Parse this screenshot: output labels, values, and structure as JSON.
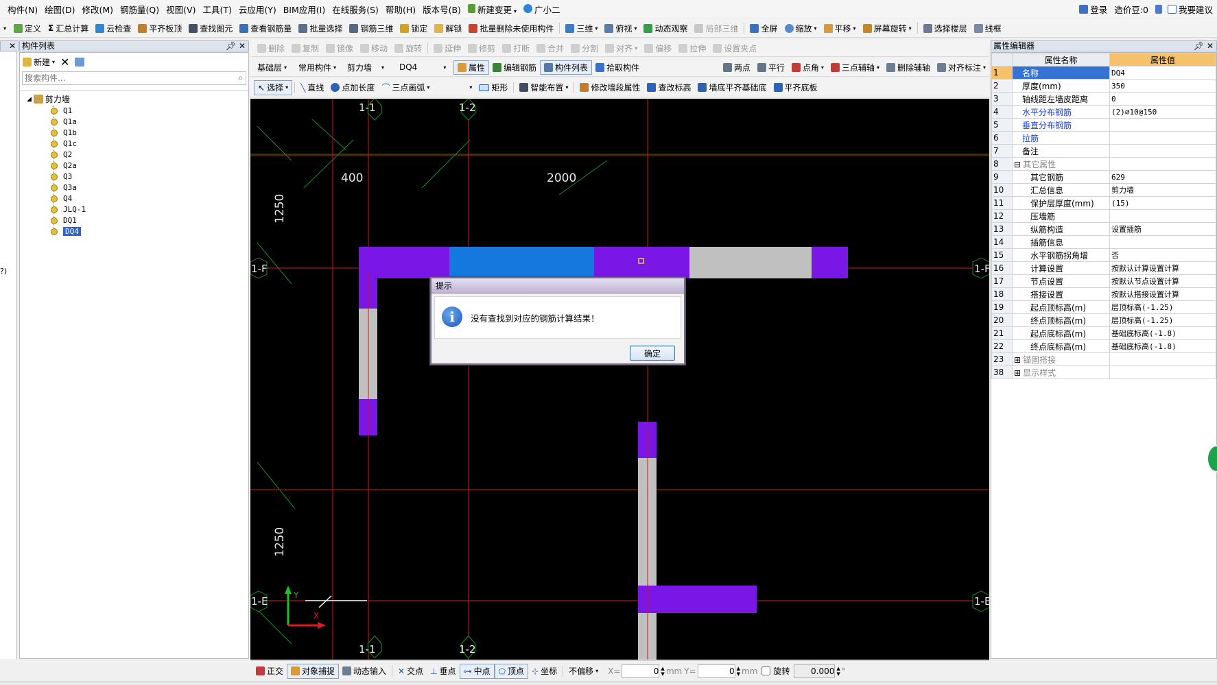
{
  "menubar": [
    "构件(N)",
    "绘图(D)",
    "修改(M)",
    "钢筋量(Q)",
    "视图(V)",
    "工具(T)",
    "云应用(Y)",
    "BIM应用(I)",
    "在线服务(S)",
    "帮助(H)",
    "版本号(B)",
    "新建变更",
    "广小二"
  ],
  "menubar_right": {
    "login": "登录",
    "coins": "造价豆:0",
    "suggest": "我要建议"
  },
  "toolbar1": [
    "定义",
    "汇总计算",
    "云检查",
    "平齐板顶",
    "查找图元",
    "查看钢筋量",
    "批量选择",
    "钢筋三维",
    "锁定",
    "解锁",
    "批量删除未使用构件",
    "三维",
    "俯视",
    "动态观察",
    "局部三维",
    "全屏",
    "缩放",
    "平移",
    "屏幕旋转",
    "选择楼层",
    "线框"
  ],
  "toolbar2": [
    "删除",
    "复制",
    "镜像",
    "移动",
    "旋转",
    "延伸",
    "修剪",
    "打断",
    "合并",
    "分割",
    "对齐",
    "偏移",
    "拉伸",
    "设置夹点"
  ],
  "toolbar3": {
    "floor": "基础层",
    "category": "常用构件",
    "type": "剪力墙",
    "name": "DQ4",
    "props": "属性",
    "edit_rebar": "编辑钢筋",
    "comp_list": "构件列表",
    "pick": "拾取构件",
    "right": [
      "两点",
      "平行",
      "点角",
      "三点辅轴",
      "删除辅轴",
      "对齐标注"
    ]
  },
  "toolbar4": [
    "选择",
    "直线",
    "点加长度",
    "三点画弧",
    "矩形",
    "智能布置",
    "修改墙段属性",
    "查改标高",
    "墙底平齐基础底",
    "平齐底板"
  ],
  "left_panel": {
    "title": "构件列表",
    "new_label": "新建",
    "search_placeholder": "搜索构件...",
    "root": "剪力墙",
    "items": [
      "Q1",
      "Q1a",
      "Q1b",
      "Q1c",
      "Q2",
      "Q2a",
      "Q3",
      "Q3a",
      "Q4",
      "JLQ-1",
      "DQ1",
      "DQ4"
    ],
    "selected": "DQ4",
    "edge_text": "?)"
  },
  "canvas": {
    "axes": {
      "c1": "1-1",
      "c2": "1-2",
      "rF": "1-F",
      "rE": "1-E"
    },
    "dims": {
      "d400": "400",
      "d2000": "2000",
      "d1250a": "1250",
      "d1250b": "1250"
    },
    "axis_y": "Y",
    "axis_x": "X"
  },
  "dialog": {
    "title": "提示",
    "message": "没有查找到对应的钢筋计算结果！",
    "ok": "确定"
  },
  "props": {
    "title": "属性编辑器",
    "col_name": "属性名称",
    "col_value": "属性值",
    "rows": [
      {
        "n": "1",
        "name": "名称",
        "value": "DQ4",
        "style": "sel"
      },
      {
        "n": "2",
        "name": "厚度(mm)",
        "value": "350",
        "style": ""
      },
      {
        "n": "3",
        "name": "轴线距左墙皮距离",
        "value": "0",
        "style": ""
      },
      {
        "n": "4",
        "name": "水平分布钢筋",
        "value": "(2)⌀10@150",
        "style": "blue"
      },
      {
        "n": "5",
        "name": "垂直分布钢筋",
        "value": "",
        "style": "blue"
      },
      {
        "n": "6",
        "name": "拉筋",
        "value": "",
        "style": "blue"
      },
      {
        "n": "7",
        "name": "备注",
        "value": "",
        "style": ""
      },
      {
        "n": "8",
        "name": "其它属性",
        "value": "",
        "style": "group"
      },
      {
        "n": "9",
        "name": "其它钢筋",
        "value": "629",
        "style": "sub"
      },
      {
        "n": "10",
        "name": "汇总信息",
        "value": "剪力墙",
        "style": "sub"
      },
      {
        "n": "11",
        "name": "保护层厚度(mm)",
        "value": "(15)",
        "style": "sub"
      },
      {
        "n": "12",
        "name": "压墙筋",
        "value": "",
        "style": "sub"
      },
      {
        "n": "13",
        "name": "纵筋构造",
        "value": "设置插筋",
        "style": "sub"
      },
      {
        "n": "14",
        "name": "插筋信息",
        "value": "",
        "style": "sub"
      },
      {
        "n": "15",
        "name": "水平钢筋拐角增",
        "value": "否",
        "style": "sub"
      },
      {
        "n": "16",
        "name": "计算设置",
        "value": "按默认计算设置计算",
        "style": "sub"
      },
      {
        "n": "17",
        "name": "节点设置",
        "value": "按默认节点设置计算",
        "style": "sub"
      },
      {
        "n": "18",
        "name": "搭接设置",
        "value": "按默认搭接设置计算",
        "style": "sub"
      },
      {
        "n": "19",
        "name": "起点顶标高(m)",
        "value": "层顶标高(-1.25)",
        "style": "sub"
      },
      {
        "n": "20",
        "name": "终点顶标高(m)",
        "value": "层顶标高(-1.25)",
        "style": "sub"
      },
      {
        "n": "21",
        "name": "起点底标高(m)",
        "value": "基础底标高(-1.8)",
        "style": "sub"
      },
      {
        "n": "22",
        "name": "终点底标高(m)",
        "value": "基础底标高(-1.8)",
        "style": "sub"
      },
      {
        "n": "23",
        "name": "锚固搭接",
        "value": "",
        "style": "group"
      },
      {
        "n": "38",
        "name": "显示样式",
        "value": "",
        "style": "group"
      }
    ]
  },
  "statusbar": {
    "items": [
      "正交",
      "对象捕捉",
      "动态输入",
      "交点",
      "垂点",
      "中点",
      "顶点",
      "坐标"
    ],
    "offset": "不偏移",
    "x_label": "X=",
    "x_value": "0",
    "y_label": "Y=",
    "y_value": "0",
    "mm": "mm",
    "rotate_label": "旋转",
    "rotate_value": "0.000",
    "deg": "°"
  },
  "colors": {
    "purple": "#7a16e6",
    "blue": "#1478dc",
    "grey": "#c0c0c0",
    "green_axis": "#1e8a1e",
    "red_axis": "#d01818"
  }
}
